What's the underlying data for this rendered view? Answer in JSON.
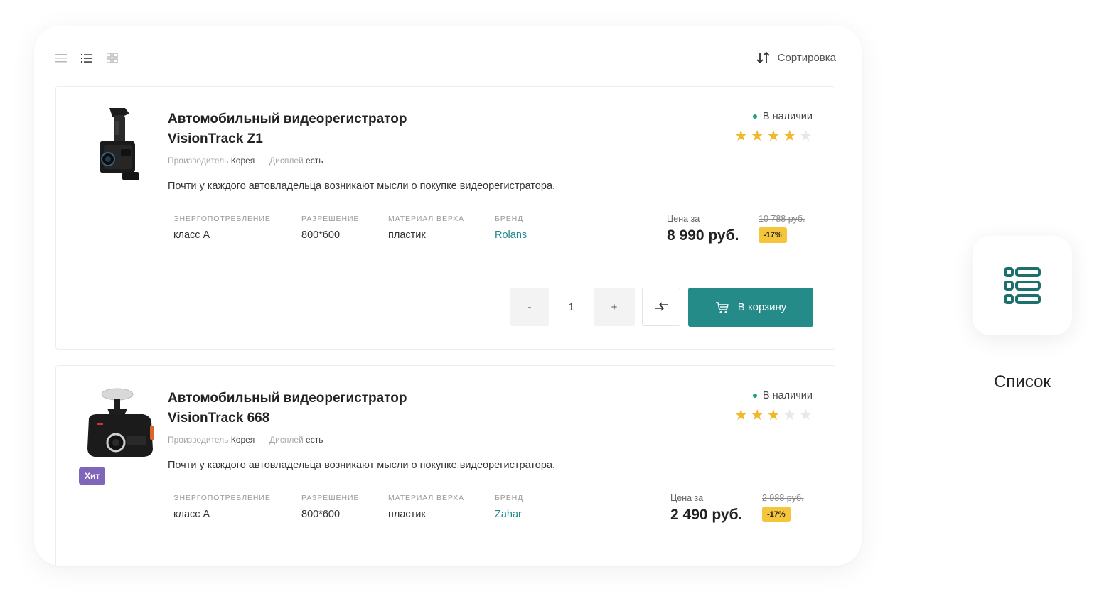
{
  "toolbar": {
    "views": [
      "list-compact",
      "list",
      "grid"
    ],
    "active_view": "list",
    "sort_label": "Сортировка"
  },
  "products": [
    {
      "title_line1": "Автомобильный видеорегистратор",
      "title_line2": "VisionTrack Z1",
      "manufacturer_label": "Производитель",
      "manufacturer_value": "Корея",
      "display_label": "Дисплей",
      "display_value": "есть",
      "description": "Почти у каждого автовладельца возникают мысли о покупке видеорегистратора.",
      "specs": [
        {
          "label": "Энергопотребление",
          "value": "класс А"
        },
        {
          "label": "Разрешение",
          "value": "800*600"
        },
        {
          "label": "Материал верха",
          "value": "пластик"
        },
        {
          "label": "Бренд",
          "value": "Rolans"
        }
      ],
      "availability": "В наличии",
      "rating": 4,
      "rating_max": 5,
      "price_label": "Цена за",
      "old_price": "10 788 руб.",
      "price": "8 990 руб.",
      "discount": "-17%",
      "qty_minus": "-",
      "qty": "1",
      "qty_plus": "+",
      "cart_label": "В корзину"
    },
    {
      "title_line1": "Автомобильный видеорегистратор",
      "title_line2": "VisionTrack 668",
      "badge": "Хит",
      "manufacturer_label": "Производитель",
      "manufacturer_value": "Корея",
      "display_label": "Дисплей",
      "display_value": "есть",
      "description": "Почти у каждого автовладельца возникают мысли о покупке видеорегистратора.",
      "specs": [
        {
          "label": "Энергопотребление",
          "value": "класс А"
        },
        {
          "label": "Разрешение",
          "value": "800*600"
        },
        {
          "label": "Материал верха",
          "value": "пластик"
        },
        {
          "label": "Бренд",
          "value": "Zahar"
        }
      ],
      "availability": "В наличии",
      "rating": 3,
      "rating_max": 5,
      "price_label": "Цена за",
      "old_price": "2 988 руб.",
      "price": "2 490 руб.",
      "discount": "-17%"
    }
  ],
  "side": {
    "icon": "list-view-icon",
    "label": "Список"
  },
  "colors": {
    "accent": "#248b89",
    "brand_link": "#1f8a8a",
    "star_on": "#f0b92b",
    "star_off": "#e8e8e8",
    "discount_bg": "#f5c53b",
    "hit_badge": "#7f66b8",
    "in_stock_dot": "#1fa37a"
  }
}
